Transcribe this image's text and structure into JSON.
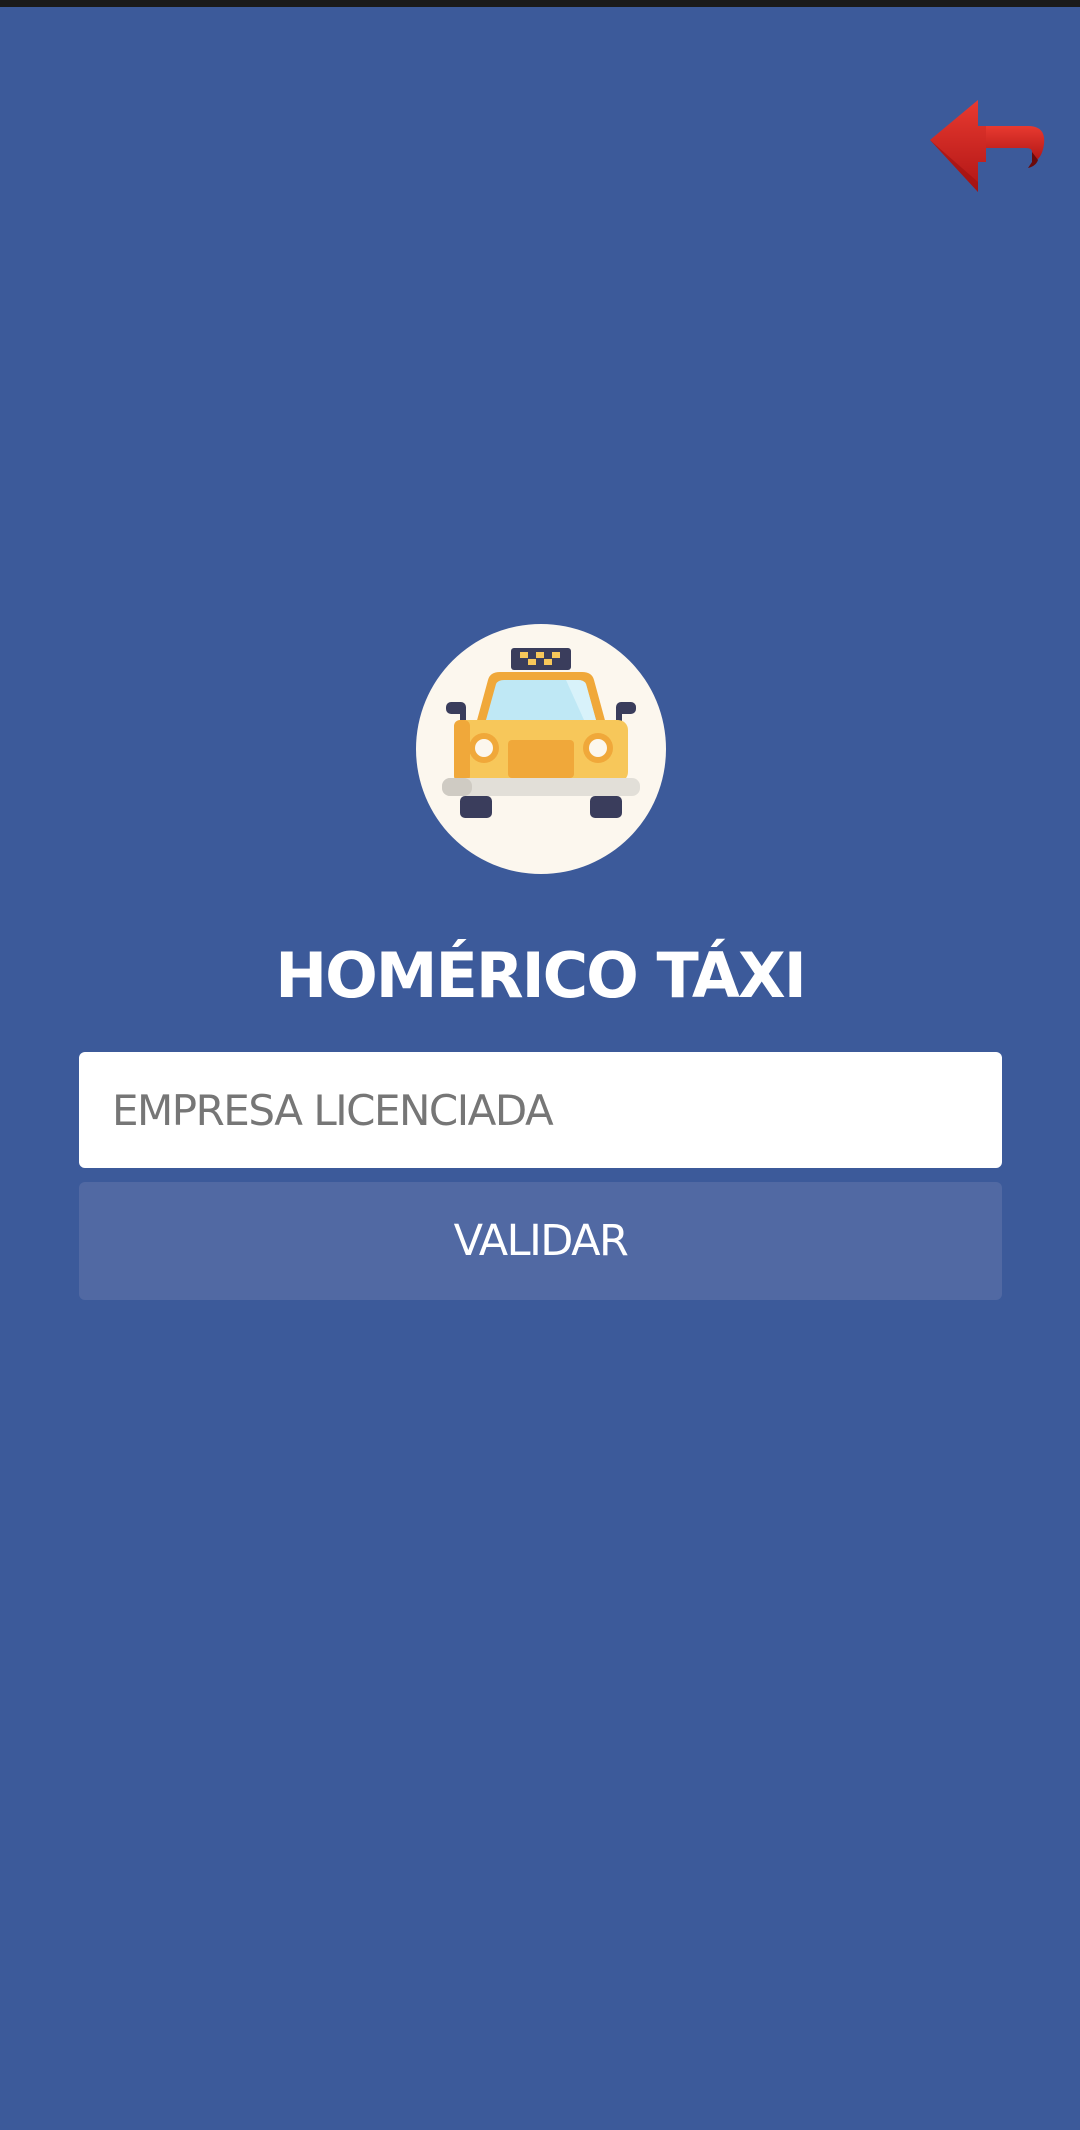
{
  "header": {
    "back_icon": "red-back-arrow-icon"
  },
  "logo": {
    "icon": "taxi-car-icon"
  },
  "app": {
    "title": "HOMÉRICO TÁXI"
  },
  "form": {
    "company_placeholder": "EMPRESA LICENCIADA",
    "company_value": "",
    "validate_label": "VALIDAR"
  },
  "colors": {
    "background": "#3c5a9a",
    "button": "#5169a3",
    "input_background": "#ffffff",
    "back_arrow": "#d42020",
    "taxi_body": "#f7c75a"
  }
}
